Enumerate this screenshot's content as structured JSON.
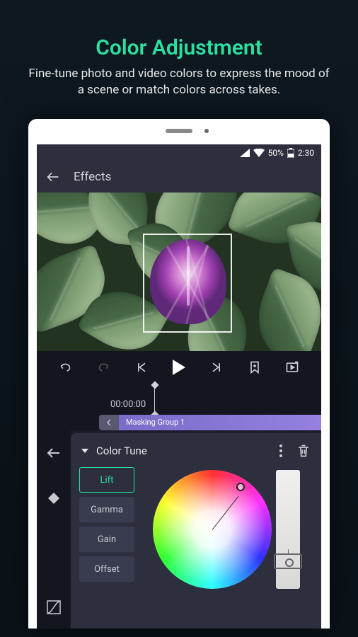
{
  "promo": {
    "title": "Color Adjustment",
    "subtitle": "Fine-tune photo and video colors to express the mood of a scene or match colors across takes."
  },
  "status_bar": {
    "battery_pct": "50%",
    "time": "2:30"
  },
  "header": {
    "title": "Effects"
  },
  "timeline": {
    "timecode": "00:00:00",
    "clip_label": "Masking Group 1"
  },
  "panel": {
    "title": "Color Tune",
    "params": [
      {
        "label": "Lift",
        "active": true
      },
      {
        "label": "Gamma",
        "active": false
      },
      {
        "label": "Gain",
        "active": false
      },
      {
        "label": "Offset",
        "active": false
      }
    ]
  },
  "colors": {
    "accent": "#2de0a0"
  }
}
